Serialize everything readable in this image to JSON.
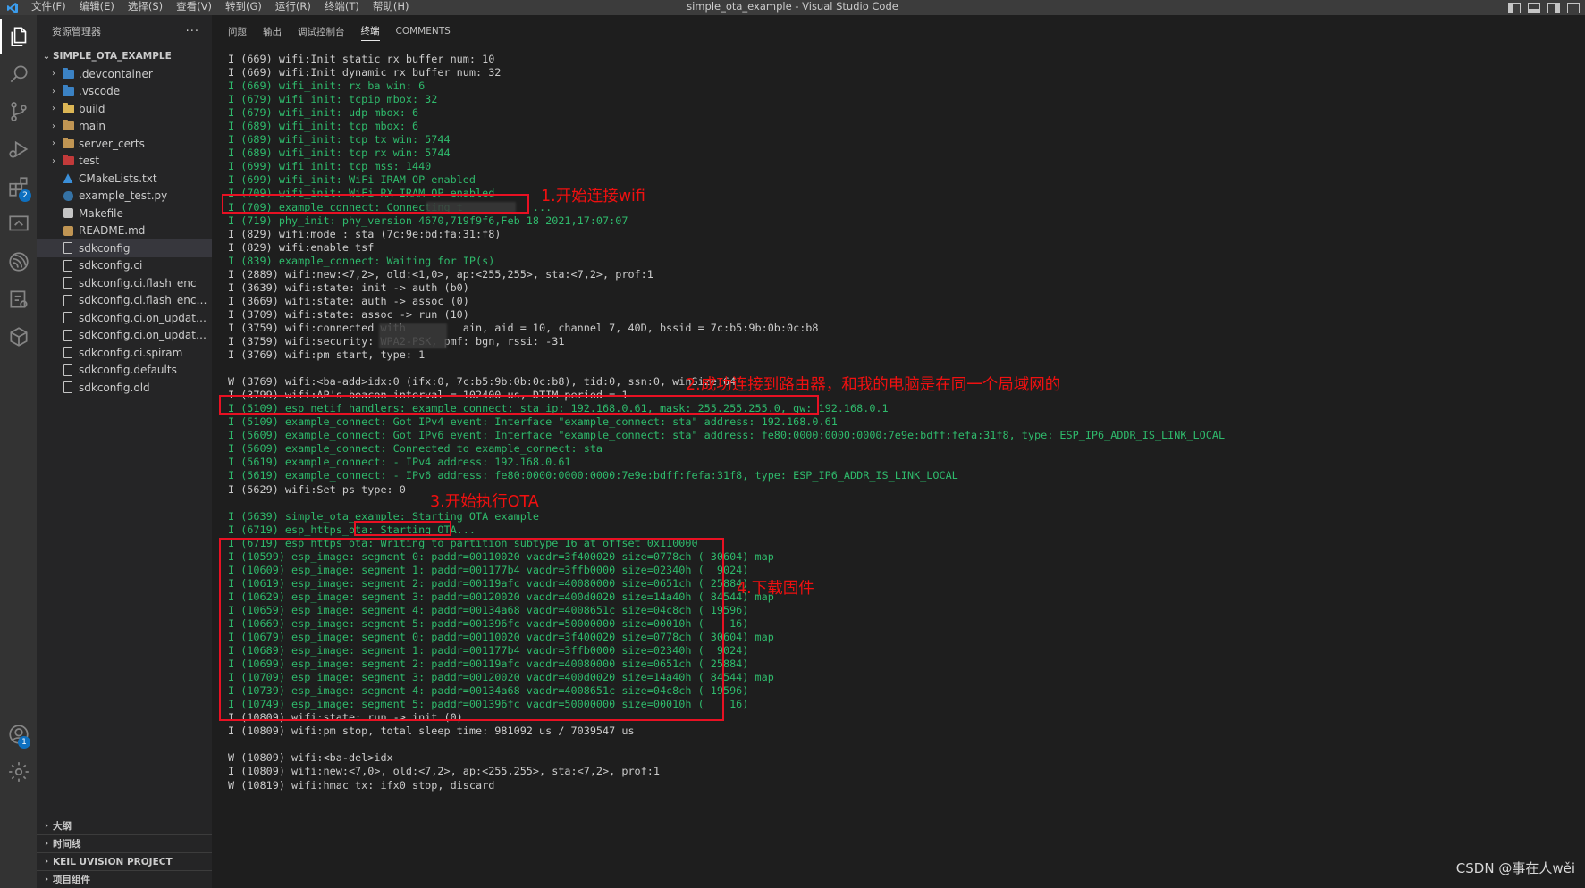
{
  "window": {
    "title": "simple_ota_example - Visual Studio Code",
    "menu": [
      "文件(F)",
      "编辑(E)",
      "选择(S)",
      "查看(V)",
      "转到(G)",
      "运行(R)",
      "终端(T)",
      "帮助(H)"
    ]
  },
  "activity_bar": {
    "extensions_badge": "2",
    "accounts_badge": "1"
  },
  "sidebar": {
    "title": "资源管理器",
    "more": "···",
    "project": "SIMPLE_OTA_EXAMPLE",
    "items": [
      {
        "label": ".devcontainer",
        "type": "folder",
        "icon": "devcontainer-folder-icon",
        "color": "#3b82c4"
      },
      {
        "label": ".vscode",
        "type": "folder",
        "icon": "vscode-folder-icon",
        "color": "#3b82c4"
      },
      {
        "label": "build",
        "type": "folder",
        "icon": "build-folder-icon",
        "color": "#dcb655"
      },
      {
        "label": "main",
        "type": "folder",
        "icon": "folder-icon",
        "color": "#c09553"
      },
      {
        "label": "server_certs",
        "type": "folder",
        "icon": "folder-icon",
        "color": "#c09553"
      },
      {
        "label": "test",
        "type": "folder",
        "icon": "test-folder-icon",
        "color": "#c23a3a"
      },
      {
        "label": "CMakeLists.txt",
        "type": "file",
        "icon": "cmake-icon",
        "color": "#3b8fd9"
      },
      {
        "label": "example_test.py",
        "type": "file",
        "icon": "python-icon",
        "color": "#3572a5"
      },
      {
        "label": "Makefile",
        "type": "file",
        "icon": "makefile-icon",
        "color": "#c5c5c5"
      },
      {
        "label": "README.md",
        "type": "file",
        "icon": "markdown-icon",
        "color": "#c09553"
      },
      {
        "label": "sdkconfig",
        "type": "file",
        "icon": "file-icon",
        "color": "#c5c5c5",
        "selected": true
      },
      {
        "label": "sdkconfig.ci",
        "type": "file",
        "icon": "file-icon",
        "color": "#c5c5c5"
      },
      {
        "label": "sdkconfig.ci.flash_enc",
        "type": "file",
        "icon": "file-icon",
        "color": "#c5c5c5"
      },
      {
        "label": "sdkconfig.ci.flash_enc_wifi",
        "type": "file",
        "icon": "file-icon",
        "color": "#c5c5c5"
      },
      {
        "label": "sdkconfig.ci.on_update_no...",
        "type": "file",
        "icon": "file-icon",
        "color": "#c5c5c5"
      },
      {
        "label": "sdkconfig.ci.on_update_no...",
        "type": "file",
        "icon": "file-icon",
        "color": "#c5c5c5"
      },
      {
        "label": "sdkconfig.ci.spiram",
        "type": "file",
        "icon": "file-icon",
        "color": "#c5c5c5"
      },
      {
        "label": "sdkconfig.defaults",
        "type": "file",
        "icon": "file-icon",
        "color": "#c5c5c5"
      },
      {
        "label": "sdkconfig.old",
        "type": "file",
        "icon": "file-icon",
        "color": "#c5c5c5"
      }
    ],
    "sections": [
      "大纲",
      "时间线",
      "KEIL UVISION PROJECT",
      "项目组件"
    ]
  },
  "panel": {
    "tabs": [
      "问题",
      "输出",
      "调试控制台",
      "终端",
      "COMMENTS"
    ],
    "active_tab": "终端"
  },
  "terminal": {
    "lines": [
      {
        "text": "I (669) wifi:Init static rx buffer num: 10",
        "color": "w"
      },
      {
        "text": "I (669) wifi:Init dynamic rx buffer num: 32",
        "color": "w"
      },
      {
        "text": "I (669) wifi_init: rx ba win: 6",
        "color": "g"
      },
      {
        "text": "I (679) wifi_init: tcpip mbox: 32",
        "color": "g"
      },
      {
        "text": "I (679) wifi_init: udp mbox: 6",
        "color": "g"
      },
      {
        "text": "I (689) wifi_init: tcp mbox: 6",
        "color": "g"
      },
      {
        "text": "I (689) wifi_init: tcp tx win: 5744",
        "color": "g"
      },
      {
        "text": "I (689) wifi_init: tcp rx win: 5744",
        "color": "g"
      },
      {
        "text": "I (699) wifi_init: tcp mss: 1440",
        "color": "g"
      },
      {
        "text": "I (699) wifi_init: WiFi IRAM OP enabled",
        "color": "g"
      },
      {
        "text": "I (709) wifi_init: WiFi RX IRAM OP enabled",
        "color": "g"
      },
      {
        "text": "I (709) example_connect: Connecting t           ...",
        "color": "g"
      },
      {
        "text": "I (719) phy_init: phy_version 4670,719f9f6,Feb 18 2021,17:07:07",
        "color": "g"
      },
      {
        "text": "I (829) wifi:mode : sta (7c:9e:bd:fa:31:f8)",
        "color": "w"
      },
      {
        "text": "I (829) wifi:enable tsf",
        "color": "w"
      },
      {
        "text": "I (839) example_connect: Waiting for IP(s)",
        "color": "g"
      },
      {
        "text": "I (2889) wifi:new:<7,2>, old:<1,0>, ap:<255,255>, sta:<7,2>, prof:1",
        "color": "w"
      },
      {
        "text": "I (3639) wifi:state: init -> auth (b0)",
        "color": "w"
      },
      {
        "text": "I (3669) wifi:state: auth -> assoc (0)",
        "color": "w"
      },
      {
        "text": "I (3709) wifi:state: assoc -> run (10)",
        "color": "w"
      },
      {
        "text": "I (3759) wifi:connected with         ain, aid = 10, channel 7, 40D, bssid = 7c:b5:9b:0b:0c:b8",
        "color": "w"
      },
      {
        "text": "I (3759) wifi:security: WPA2-PSK, pmf: bgn, rssi: -31",
        "color": "w"
      },
      {
        "text": "I (3769) wifi:pm start, type: 1",
        "color": "w"
      },
      {
        "text": "",
        "color": "w"
      },
      {
        "text": "W (3769) wifi:<ba-add>idx:0 (ifx:0, 7c:b5:9b:0b:0c:b8), tid:0, ssn:0, winSize:64",
        "color": "w"
      },
      {
        "text": "I (3799) wifi:AP's beacon interval = 102400 us, DTIM period = 1",
        "color": "w"
      },
      {
        "text": "I (5109) esp_netif_handlers: example_connect: sta ip: 192.168.0.61, mask: 255.255.255.0, gw: 192.168.0.1",
        "color": "g"
      },
      {
        "text": "I (5109) example_connect: Got IPv4 event: Interface \"example_connect: sta\" address: 192.168.0.61",
        "color": "g"
      },
      {
        "text": "I (5609) example_connect: Got IPv6 event: Interface \"example_connect: sta\" address: fe80:0000:0000:0000:7e9e:bdff:fefa:31f8, type: ESP_IP6_ADDR_IS_LINK_LOCAL",
        "color": "g"
      },
      {
        "text": "I (5609) example_connect: Connected to example_connect: sta",
        "color": "g"
      },
      {
        "text": "I (5619) example_connect: - IPv4 address: 192.168.0.61",
        "color": "g"
      },
      {
        "text": "I (5619) example_connect: - IPv6 address: fe80:0000:0000:0000:7e9e:bdff:fefa:31f8, type: ESP_IP6_ADDR_IS_LINK_LOCAL",
        "color": "g"
      },
      {
        "text": "I (5629) wifi:Set ps type: 0",
        "color": "w"
      },
      {
        "text": "",
        "color": "w"
      },
      {
        "text": "I (5639) simple_ota_example: Starting OTA example",
        "color": "g"
      },
      {
        "text": "I (6719) esp_https_ota: Starting OTA...",
        "color": "g"
      },
      {
        "text": "I (6719) esp_https_ota: Writing to partition subtype 16 at offset 0x110000",
        "color": "g"
      },
      {
        "text": "I (10599) esp_image: segment 0: paddr=00110020 vaddr=3f400020 size=0778ch ( 30604) map",
        "color": "g"
      },
      {
        "text": "I (10609) esp_image: segment 1: paddr=001177b4 vaddr=3ffb0000 size=02340h (  9024)",
        "color": "g"
      },
      {
        "text": "I (10619) esp_image: segment 2: paddr=00119afc vaddr=40080000 size=0651ch ( 25884)",
        "color": "g"
      },
      {
        "text": "I (10629) esp_image: segment 3: paddr=00120020 vaddr=400d0020 size=14a40h ( 84544) map",
        "color": "g"
      },
      {
        "text": "I (10659) esp_image: segment 4: paddr=00134a68 vaddr=4008651c size=04c8ch ( 19596)",
        "color": "g"
      },
      {
        "text": "I (10669) esp_image: segment 5: paddr=001396fc vaddr=50000000 size=00010h (    16)",
        "color": "g"
      },
      {
        "text": "I (10679) esp_image: segment 0: paddr=00110020 vaddr=3f400020 size=0778ch ( 30604) map",
        "color": "g"
      },
      {
        "text": "I (10689) esp_image: segment 1: paddr=001177b4 vaddr=3ffb0000 size=02340h (  9024)",
        "color": "g"
      },
      {
        "text": "I (10699) esp_image: segment 2: paddr=00119afc vaddr=40080000 size=0651ch ( 25884)",
        "color": "g"
      },
      {
        "text": "I (10709) esp_image: segment 3: paddr=00120020 vaddr=400d0020 size=14a40h ( 84544) map",
        "color": "g"
      },
      {
        "text": "I (10739) esp_image: segment 4: paddr=00134a68 vaddr=4008651c size=04c8ch ( 19596)",
        "color": "g"
      },
      {
        "text": "I (10749) esp_image: segment 5: paddr=001396fc vaddr=50000000 size=00010h (    16)",
        "color": "g"
      },
      {
        "text": "I (10809) wifi:state: run -> init (0)",
        "color": "w"
      },
      {
        "text": "I (10809) wifi:pm stop, total sleep time: 981092 us / 7039547 us",
        "color": "w"
      },
      {
        "text": "",
        "color": "w"
      },
      {
        "text": "W (10809) wifi:<ba-del>idx",
        "color": "w"
      },
      {
        "text": "I (10809) wifi:new:<7,0>, old:<7,2>, ap:<255,255>, sta:<7,2>, prof:1",
        "color": "w"
      },
      {
        "text": "W (10819) wifi:hmac tx: ifx0 stop, discard",
        "color": "w"
      }
    ]
  },
  "annotations": {
    "a1": "1.开始连接wifi",
    "a2": "2.成功连接到路由器，和我的电脑是在同一个局域网的",
    "a3": "3.开始执行OTA",
    "a4": "4.下载固件"
  },
  "colors": {
    "terminal_white": "#cccccc",
    "terminal_green": "#2fba6c",
    "annotation_red": "#e81123"
  },
  "watermark": "CSDN @事在人wěi"
}
